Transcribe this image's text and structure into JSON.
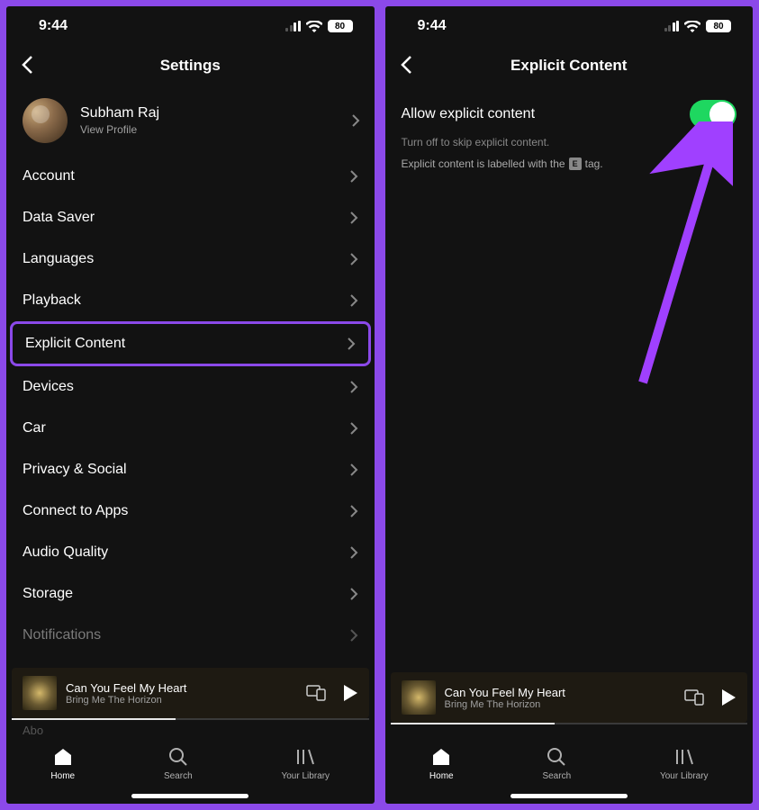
{
  "status": {
    "time": "9:44",
    "battery": "80"
  },
  "left": {
    "title": "Settings",
    "profile": {
      "name": "Subham Raj",
      "sub": "View Profile"
    },
    "items": [
      {
        "label": "Account"
      },
      {
        "label": "Data Saver"
      },
      {
        "label": "Languages"
      },
      {
        "label": "Playback"
      },
      {
        "label": "Explicit Content",
        "highlight": true
      },
      {
        "label": "Devices"
      },
      {
        "label": "Car"
      },
      {
        "label": "Privacy & Social"
      },
      {
        "label": "Connect to Apps"
      },
      {
        "label": "Audio Quality"
      },
      {
        "label": "Storage"
      },
      {
        "label": "Notifications",
        "dim": true
      }
    ]
  },
  "right": {
    "title": "Explicit Content",
    "toggle_label": "Allow explicit content",
    "helper1": "Turn off to skip explicit content.",
    "helper2a": "Explicit content is labelled with the",
    "helper2b": "tag.",
    "e_tag": "E"
  },
  "now_playing": {
    "title": "Can You Feel My Heart",
    "artist": "Bring Me The Horizon"
  },
  "tabs": {
    "home": "Home",
    "search": "Search",
    "library": "Your Library"
  }
}
